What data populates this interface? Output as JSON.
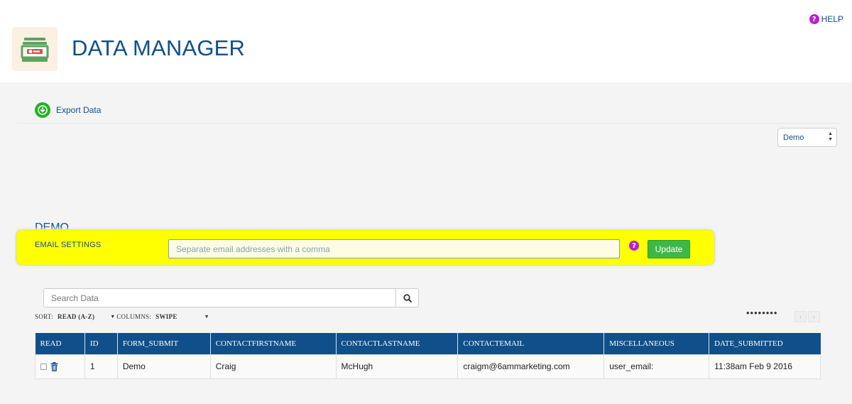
{
  "header": {
    "title": "DATA MANAGER",
    "help_label": "HELP",
    "help_icon_glyph": "?",
    "logo_icon": "database-drawer-icon"
  },
  "toolbar": {
    "export_label": "Export Data",
    "export_icon": "download-icon"
  },
  "database_select": {
    "selected": "Demo"
  },
  "section": {
    "title": "DEMO"
  },
  "email_settings": {
    "label": "EMAIL SETTINGS",
    "value": "",
    "placeholder": "Separate email addresses with a comma",
    "help_glyph": "?",
    "update_label": "Update"
  },
  "search": {
    "placeholder": "Search Data",
    "value": "",
    "icon": "search-icon"
  },
  "sort": {
    "sort_label": "SORT:",
    "sort_value": "READ (A-Z)",
    "columns_label": "COLUMNS:",
    "columns_value": "SWIPE"
  },
  "pager": {
    "dots": "••••••••",
    "prev": "‹",
    "next": "›"
  },
  "table": {
    "headers": [
      "READ",
      "ID",
      "FORM_SUBMIT",
      "CONTACTFIRSTNAME",
      "CONTACTLASTNAME",
      "CONTACTEMAIL",
      "MISCELLANEOUS",
      "DATE_SUBMITTED"
    ],
    "rows": [
      {
        "id": "1",
        "form_submit": "Demo",
        "contactfirstname": "Craig",
        "contactlastname": "McHugh",
        "contactemail": "craigm@6ammarketing.com",
        "miscellaneous": "user_email:",
        "date_submitted": "11:38am Feb 9 2016"
      }
    ]
  },
  "colors": {
    "brand_blue": "#0d4f8b",
    "header_bg": "#104f8a",
    "highlight_yellow": "#ffff00",
    "update_green": "#3db847",
    "export_green": "#28b228",
    "help_purple": "#b81fd6"
  }
}
